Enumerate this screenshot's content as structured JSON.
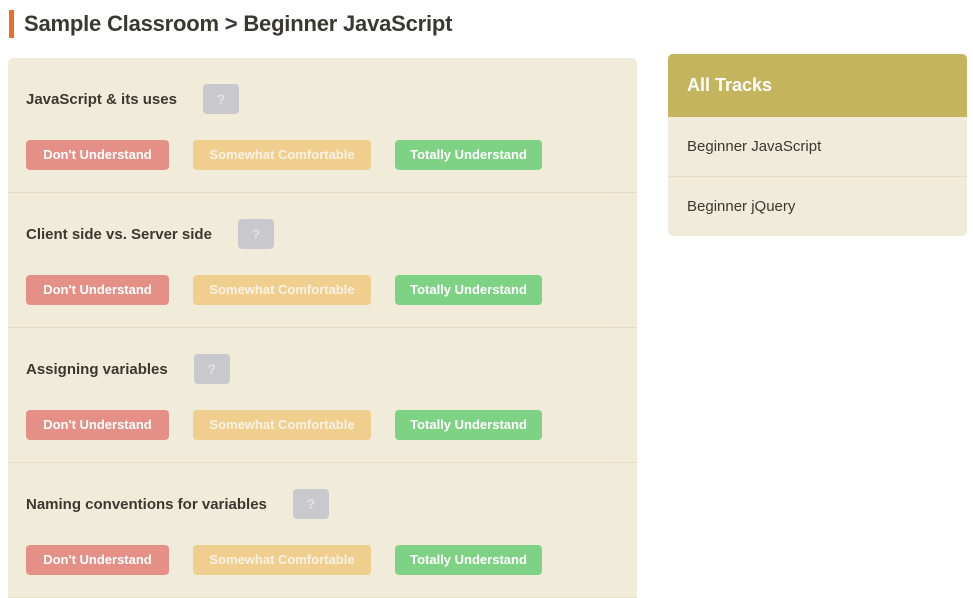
{
  "header": {
    "title": "Sample Classroom > Beginner JavaScript",
    "accent_color": "#e8702a",
    "title_color": "#3a382f"
  },
  "main": {
    "panel_color": "#f1ebda",
    "help_badge_label": "?",
    "answers": {
      "dont_label": "Don't Understand",
      "somewhat_label": "Somewhat Comfortable",
      "totally_label": "Totally Understand",
      "dont_color": "#e59086",
      "somewhat_color": "#efce8e",
      "totally_color": "#7ed284"
    },
    "questions": [
      {
        "title": "JavaScript & its uses"
      },
      {
        "title": "Client side vs. Server side"
      },
      {
        "title": "Assigning variables"
      },
      {
        "title": "Naming conventions for variables"
      }
    ]
  },
  "sidebar": {
    "header_title": "All Tracks",
    "header_color": "#c4b45d",
    "items": [
      {
        "label": "Beginner JavaScript"
      },
      {
        "label": "Beginner jQuery"
      }
    ]
  }
}
